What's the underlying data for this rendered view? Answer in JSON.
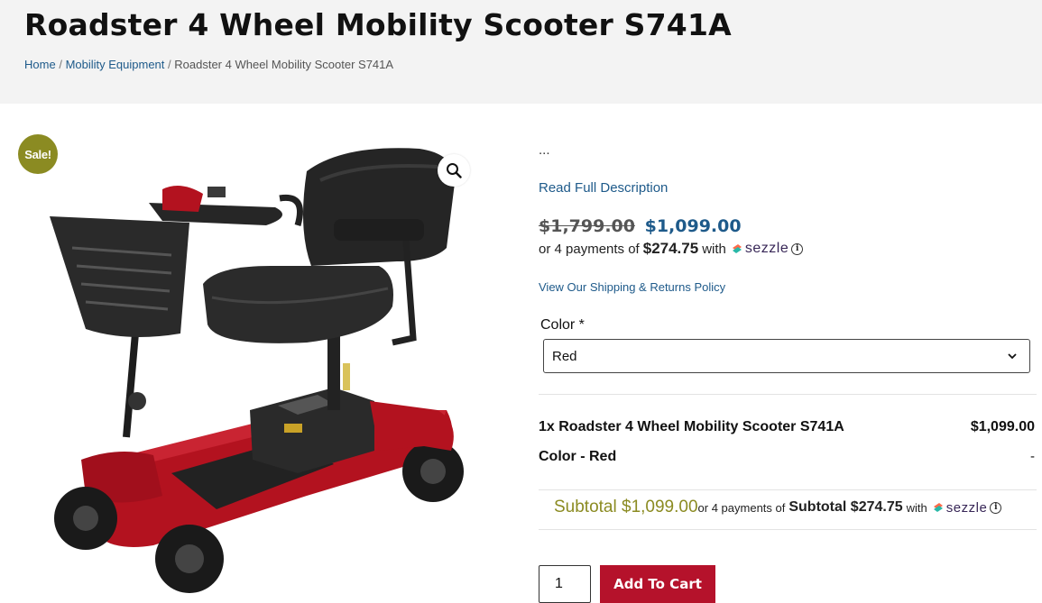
{
  "header": {
    "title": "Roadster 4 Wheel Mobility Scooter S741A",
    "breadcrumb": {
      "home": "Home",
      "separator": "/",
      "category": "Mobility Equipment",
      "current": "Roadster 4 Wheel Mobility Scooter S741A"
    }
  },
  "gallery": {
    "sale_badge": "Sale!",
    "zoom_icon": "magnifier-icon"
  },
  "product": {
    "excerpt": "...",
    "read_more": "Read Full Description",
    "old_price": "$1,799.00",
    "price": "$1,099.00",
    "installments_prefix": "or 4 payments of",
    "installment_amount": "$274.75",
    "installments_with": "with",
    "sezzle_brand": "sezzle",
    "info_glyph": "i",
    "shipping_link": "View Our Shipping & Returns Policy",
    "color_label": "Color *",
    "color_selected": "Red"
  },
  "summary": {
    "item_name": "1x Roadster 4 Wheel Mobility Scooter S741A",
    "item_price": "$1,099.00",
    "color_line": "Color - Red",
    "color_value": "-",
    "subtotal": "Subtotal $1,099.00",
    "subtotal_installments_prefix": "or 4 payments of",
    "subtotal_installment_amount": "Subtotal $274.75",
    "subtotal_with": "with",
    "sezzle_brand": "sezzle",
    "info_glyph": "i"
  },
  "cart": {
    "quantity": "1",
    "add_to_cart": "Add To Cart"
  },
  "colors": {
    "accent_blue": "#1e5a8a",
    "sale_olive": "#8b8b22",
    "cart_red": "#b5122b",
    "sezzle_purple": "#382757"
  }
}
